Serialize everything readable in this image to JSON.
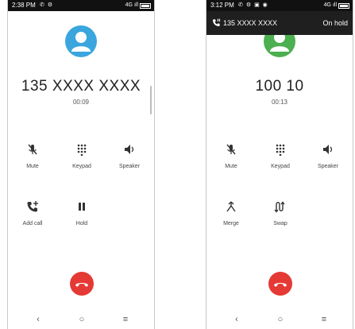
{
  "colors": {
    "avatar_left": "#3aa6dd",
    "avatar_right": "#4caf50",
    "end_call": "#e53935",
    "status_bar": "#111111",
    "hold_banner": "#1f1f1f"
  },
  "left_phone": {
    "status": {
      "time": "2:38 PM",
      "icons": [
        "phone-icon",
        "gear-icon"
      ],
      "right": "4G ıll"
    },
    "call": {
      "number": "135 XXXX XXXX",
      "timer": "00:09"
    },
    "buttons": [
      {
        "label": "Mute",
        "icon": "mute-icon"
      },
      {
        "label": "Keypad",
        "icon": "keypad-icon"
      },
      {
        "label": "Speaker",
        "icon": "speaker-icon"
      },
      {
        "label": "Add call",
        "icon": "add-call-icon"
      },
      {
        "label": "Hold",
        "icon": "pause-icon"
      }
    ],
    "nav": {
      "back": "‹",
      "home": "○",
      "menu": "≡"
    }
  },
  "right_phone": {
    "status": {
      "time": "3:12 PM",
      "icons": [
        "phone-icon",
        "gear-icon",
        "image-icon",
        "chrome-icon"
      ],
      "right": "4G ıll"
    },
    "hold_banner": {
      "number": "135 XXXX XXXX",
      "status": "On hold"
    },
    "call": {
      "number": "100 10",
      "timer": "00:13"
    },
    "buttons": [
      {
        "label": "Mute",
        "icon": "mute-icon"
      },
      {
        "label": "Keypad",
        "icon": "keypad-icon"
      },
      {
        "label": "Speaker",
        "icon": "speaker-icon"
      },
      {
        "label": "Merge",
        "icon": "merge-icon"
      },
      {
        "label": "Swap",
        "icon": "swap-icon"
      }
    ],
    "nav": {
      "back": "‹",
      "home": "○",
      "menu": "≡"
    }
  }
}
